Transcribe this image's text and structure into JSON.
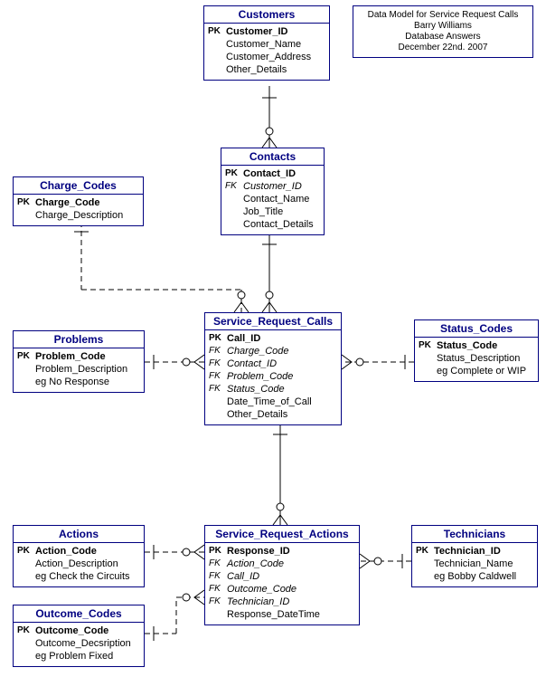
{
  "meta": {
    "line1": "Data Model for Service Request Calls",
    "line2": "Barry Williams",
    "line3": "Database Answers",
    "line4": "December 22nd. 2007"
  },
  "entities": {
    "customers": {
      "title": "Customers",
      "rows": [
        {
          "key": "PK",
          "name": "Customer_ID",
          "cls": "pk"
        },
        {
          "key": "",
          "name": "Customer_Name",
          "cls": ""
        },
        {
          "key": "",
          "name": "Customer_Address",
          "cls": ""
        },
        {
          "key": "",
          "name": "Other_Details",
          "cls": ""
        }
      ]
    },
    "contacts": {
      "title": "Contacts",
      "rows": [
        {
          "key": "PK",
          "name": "Contact_ID",
          "cls": "pk"
        },
        {
          "key": "FK",
          "name": "Customer_ID",
          "cls": "fk"
        },
        {
          "key": "",
          "name": "Contact_Name",
          "cls": ""
        },
        {
          "key": "",
          "name": "Job_Title",
          "cls": ""
        },
        {
          "key": "",
          "name": "Contact_Details",
          "cls": ""
        }
      ]
    },
    "charge_codes": {
      "title": "Charge_Codes",
      "rows": [
        {
          "key": "PK",
          "name": "Charge_Code",
          "cls": "pk"
        },
        {
          "key": "",
          "name": "Charge_Description",
          "cls": ""
        }
      ]
    },
    "problems": {
      "title": "Problems",
      "rows": [
        {
          "key": "PK",
          "name": "Problem_Code",
          "cls": "pk"
        },
        {
          "key": "",
          "name": "Problem_Description",
          "cls": ""
        },
        {
          "key": "",
          "name": "eg No Response",
          "cls": ""
        }
      ]
    },
    "service_request_calls": {
      "title": "Service_Request_Calls",
      "rows": [
        {
          "key": "PK",
          "name": "Call_ID",
          "cls": "pk"
        },
        {
          "key": "FK",
          "name": "Charge_Code",
          "cls": "fk"
        },
        {
          "key": "FK",
          "name": "Contact_ID",
          "cls": "fk"
        },
        {
          "key": "FK",
          "name": "Problem_Code",
          "cls": "fk"
        },
        {
          "key": "FK",
          "name": "Status_Code",
          "cls": "fk"
        },
        {
          "key": "",
          "name": "Date_Time_of_Call",
          "cls": ""
        },
        {
          "key": "",
          "name": "Other_Details",
          "cls": ""
        }
      ]
    },
    "status_codes": {
      "title": "Status_Codes",
      "rows": [
        {
          "key": "PK",
          "name": "Status_Code",
          "cls": "pk"
        },
        {
          "key": "",
          "name": "Status_Description",
          "cls": ""
        },
        {
          "key": "",
          "name": "eg Complete or WIP",
          "cls": ""
        }
      ]
    },
    "actions": {
      "title": "Actions",
      "rows": [
        {
          "key": "PK",
          "name": "Action_Code",
          "cls": "pk"
        },
        {
          "key": "",
          "name": "Action_Description",
          "cls": ""
        },
        {
          "key": "",
          "name": "eg Check the Circuits",
          "cls": ""
        }
      ]
    },
    "outcome_codes": {
      "title": "Outcome_Codes",
      "rows": [
        {
          "key": "PK",
          "name": "Outcome_Code",
          "cls": "pk"
        },
        {
          "key": "",
          "name": "Outcome_Decsription",
          "cls": ""
        },
        {
          "key": "",
          "name": "eg Problem Fixed",
          "cls": ""
        }
      ]
    },
    "service_request_actions": {
      "title": "Service_Request_Actions",
      "rows": [
        {
          "key": "PK",
          "name": "Response_ID",
          "cls": "pk"
        },
        {
          "key": "FK",
          "name": "Action_Code",
          "cls": "fk"
        },
        {
          "key": "FK",
          "name": "Call_ID",
          "cls": "fk"
        },
        {
          "key": "FK",
          "name": "Outcome_Code",
          "cls": "fk"
        },
        {
          "key": "FK",
          "name": "Technician_ID",
          "cls": "fk"
        },
        {
          "key": "",
          "name": "Response_DateTime",
          "cls": ""
        }
      ]
    },
    "technicians": {
      "title": "Technicians",
      "rows": [
        {
          "key": "PK",
          "name": "Technician_ID",
          "cls": "pk"
        },
        {
          "key": "",
          "name": "Technician_Name",
          "cls": ""
        },
        {
          "key": "",
          "name": "eg Bobby Caldwell",
          "cls": ""
        }
      ]
    }
  }
}
